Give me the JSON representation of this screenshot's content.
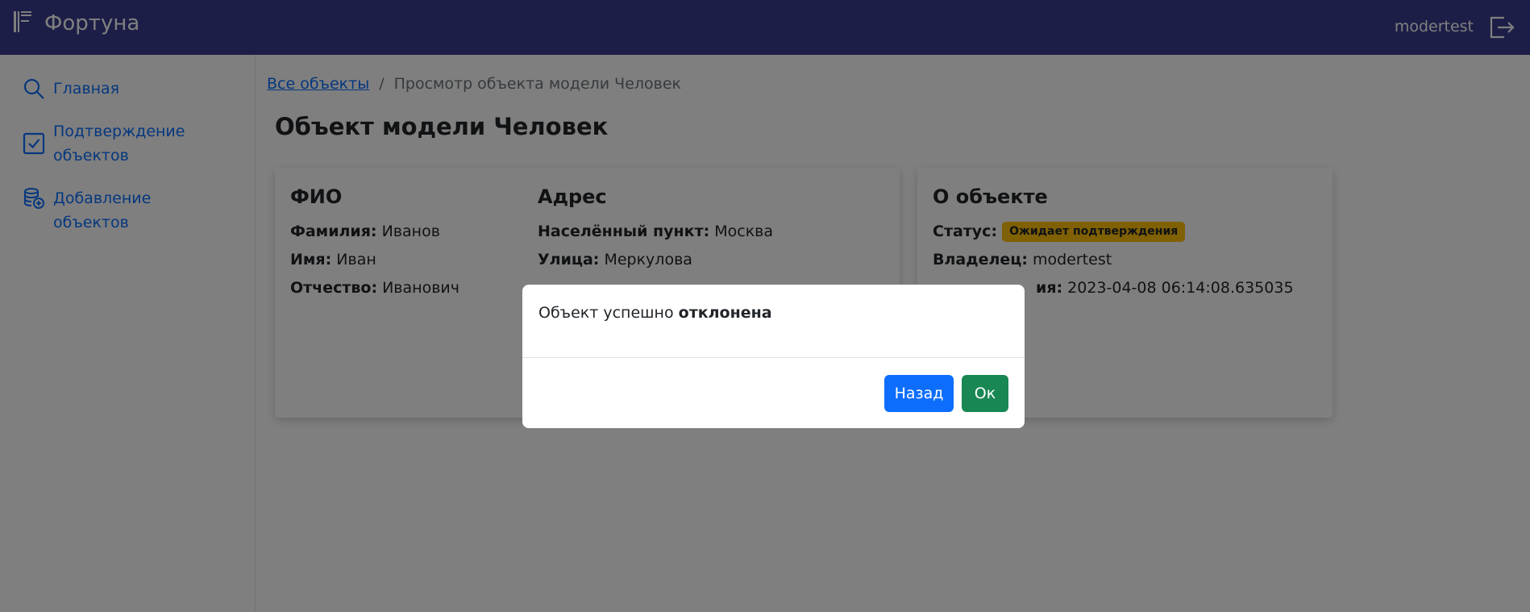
{
  "header": {
    "brand": "Фортуна",
    "username": "modertest"
  },
  "sidebar": {
    "items": [
      {
        "label": "Главная",
        "icon": "search-icon"
      },
      {
        "label": "Подтверждение объектов",
        "icon": "check-square-icon"
      },
      {
        "label": "Добавление объектов",
        "icon": "database-add-icon"
      }
    ]
  },
  "breadcrumb": {
    "link": "Все объекты",
    "separator": "/",
    "current": "Просмотр объекта модели Человек"
  },
  "page": {
    "title": "Объект модели Человек"
  },
  "person_card": {
    "fio_heading": "ФИО",
    "fio": [
      {
        "label": "Фамилия:",
        "value": "Иванов"
      },
      {
        "label": "Имя:",
        "value": "Иван"
      },
      {
        "label": "Отчество:",
        "value": "Иванович"
      }
    ],
    "address_heading": "Адрес",
    "address": [
      {
        "label": "Населённый пункт:",
        "value": "Москва"
      },
      {
        "label": "Улица:",
        "value": "Меркулова"
      }
    ]
  },
  "about_card": {
    "heading": "О объекте",
    "status_label": "Статус:",
    "status_value": "Ожидает подтверждения",
    "owner_label": "Владелец:",
    "owner_value": "modertest",
    "created_label_partial": "ия:",
    "created_value": "2023-04-08 06:14:08.635035"
  },
  "modal": {
    "text_prefix": "Объект успешно",
    "text_bold": "отклонена",
    "back_label": "Назад",
    "ok_label": "Ок"
  },
  "colors": {
    "header_bg": "#3a3d8f",
    "link": "#0d6efd",
    "badge": "#ffc107",
    "btn_primary": "#0d6efd",
    "btn_success": "#198754"
  }
}
